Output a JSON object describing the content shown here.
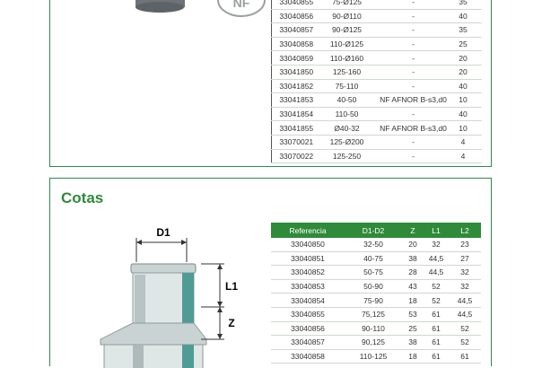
{
  "top_table": {
    "rows": [
      [
        "33040855",
        "75-Ø125",
        "-",
        "35"
      ],
      [
        "33040856",
        "90-Ø110",
        "-",
        "40"
      ],
      [
        "33040857",
        "90-Ø125",
        "-",
        "35"
      ],
      [
        "33040858",
        "110-Ø125",
        "-",
        "25"
      ],
      [
        "33040859",
        "110-Ø160",
        "-",
        "20"
      ],
      [
        "33041850",
        "125-160",
        "-",
        "20"
      ],
      [
        "33041852",
        "75-110",
        "-",
        "40"
      ],
      [
        "33041853",
        "40-50",
        "NF AFNOR B-s3,d0",
        "10"
      ],
      [
        "33041854",
        "110-50",
        "-",
        "40"
      ],
      [
        "33041855",
        "Ø40-32",
        "NF AFNOR B-s3,d0",
        "10"
      ],
      [
        "33070021",
        "125-Ø200",
        "-",
        "4"
      ],
      [
        "33070022",
        "125-250",
        "-",
        "4"
      ]
    ]
  },
  "cotas": {
    "title": "Cotas",
    "headers": [
      "Referencia",
      "D1-D2",
      "Z",
      "L1",
      "L2"
    ],
    "rows": [
      [
        "33040850",
        "32-50",
        "20",
        "32",
        "23"
      ],
      [
        "33040851",
        "40-75",
        "38",
        "44,5",
        "27"
      ],
      [
        "33040852",
        "50-75",
        "28",
        "44,5",
        "32"
      ],
      [
        "33040853",
        "50-90",
        "43",
        "52",
        "32"
      ],
      [
        "33040854",
        "75-90",
        "18",
        "52",
        "44,5"
      ],
      [
        "33040855",
        "75,125",
        "53",
        "61",
        "44,5"
      ],
      [
        "33040856",
        "90-110",
        "25",
        "61",
        "52"
      ],
      [
        "33040857",
        "90,125",
        "38",
        "61",
        "52"
      ],
      [
        "33040858",
        "110-125",
        "18",
        "61",
        "61"
      ]
    ]
  },
  "diagram": {
    "d1_label": "D1",
    "l1_label": "L1",
    "z_label": "Z",
    "nf_logo_text": "NF"
  }
}
